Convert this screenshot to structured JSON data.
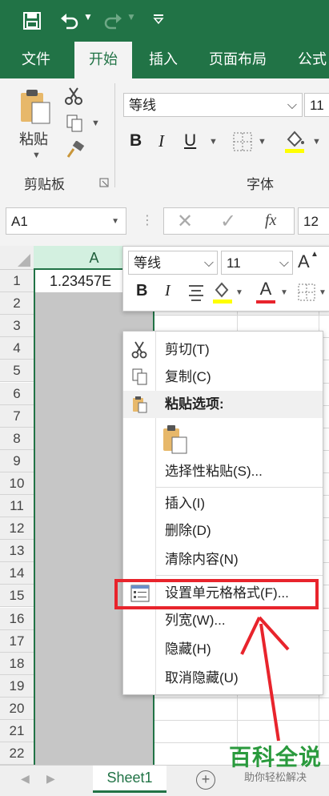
{
  "ribbon_tabs": {
    "file": "文件",
    "home": "开始",
    "insert": "插入",
    "page_layout": "页面布局",
    "formulas": "公式"
  },
  "clipboard_group": {
    "paste_label": "粘贴",
    "group_label": "剪贴板"
  },
  "font_group": {
    "font_name": "等线",
    "font_size": "11",
    "group_label": "字体",
    "bold": "B",
    "italic": "I",
    "underline": "U"
  },
  "formula_bar": {
    "name_box": "A1",
    "fx_label": "fx",
    "content": "12"
  },
  "grid": {
    "column_header": "A",
    "cell_a1": "1.23457E",
    "rows": [
      "1",
      "2",
      "3",
      "4",
      "5",
      "6",
      "7",
      "8",
      "9",
      "10",
      "11",
      "12",
      "13",
      "14",
      "15",
      "16",
      "17",
      "18",
      "19",
      "20",
      "21",
      "22"
    ]
  },
  "mini_toolbar": {
    "font_name": "等线",
    "font_size": "11",
    "bold": "B",
    "italic": "I",
    "font_color_label": "A",
    "grow_font_label": "A"
  },
  "context_menu": {
    "cut": "剪切(T)",
    "copy": "复制(C)",
    "paste_options": "粘贴选项:",
    "paste_special": "选择性粘贴(S)...",
    "insert": "插入(I)",
    "delete": "删除(D)",
    "clear_contents": "清除内容(N)",
    "format_cells": "设置单元格格式(F)...",
    "column_width": "列宽(W)...",
    "hide": "隐藏(H)",
    "unhide": "取消隐藏(U)"
  },
  "sheet_tabs": {
    "active_sheet": "Sheet1"
  },
  "watermark": {
    "title": "百科全说",
    "subtitle": "助你轻松解决"
  },
  "colors": {
    "excel_green": "#217346",
    "highlight_red": "#e8242c",
    "selection_gray": "#c6c6c6"
  }
}
